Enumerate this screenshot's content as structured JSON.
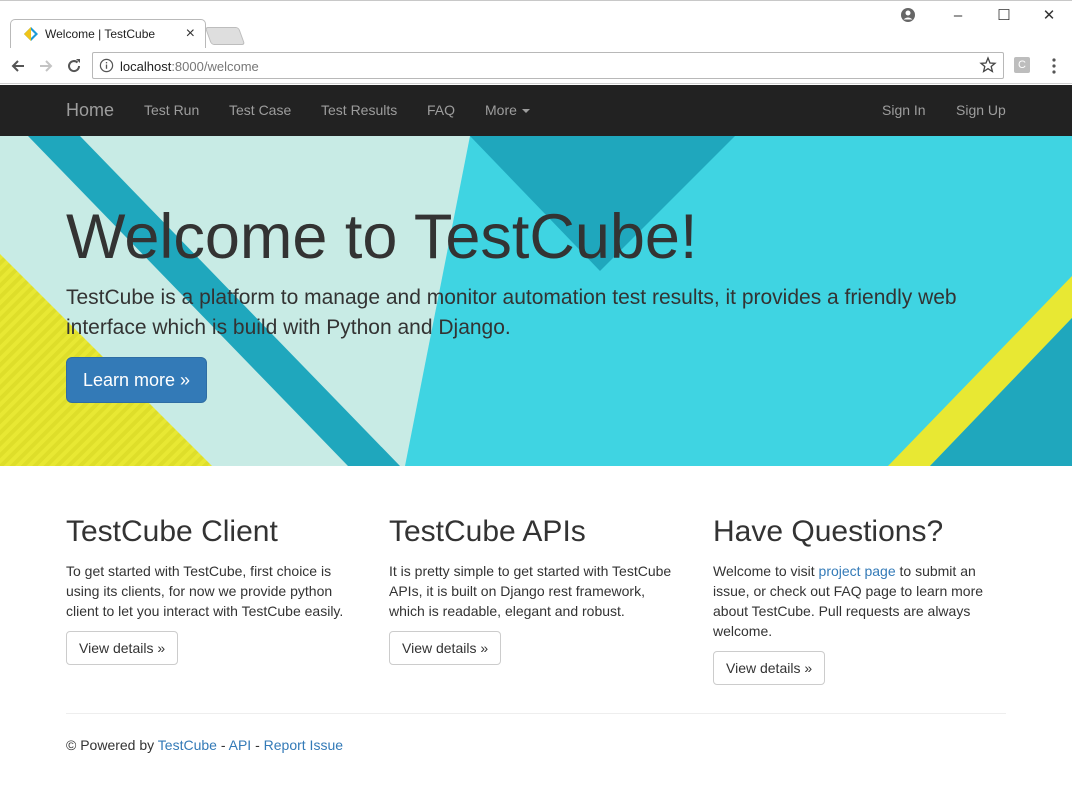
{
  "browser": {
    "tab_title": "Welcome | TestCube",
    "url_host": "localhost",
    "url_path": ":8000/welcome",
    "extension_label": "C"
  },
  "navbar": {
    "brand": "Home",
    "items": [
      "Test Run",
      "Test Case",
      "Test Results",
      "FAQ",
      "More"
    ],
    "right_items": [
      "Sign In",
      "Sign Up"
    ]
  },
  "hero": {
    "title": "Welcome to TestCube!",
    "text": "TestCube is a platform to manage and monitor automation test results, it provides a friendly web interface which is build with Python and Django.",
    "button": "Learn more »"
  },
  "columns": [
    {
      "title": "TestCube Client",
      "text": "To get started with TestCube, first choice is using its clients, for now we provide python client to let you interact with TestCube easily.",
      "button": "View details »"
    },
    {
      "title": "TestCube APIs",
      "text": "It is pretty simple to get started with TestCube APIs, it is built on Django rest framework, which is readable, elegant and robust.",
      "button": "View details »"
    },
    {
      "title": "Have Questions?",
      "text_before": "Welcome to visit ",
      "link": "project page",
      "text_after": " to submit an issue, or check out FAQ page to learn more about TestCube. Pull requests are always welcome.",
      "button": "View details »"
    }
  ],
  "footer": {
    "prefix": "© Powered by ",
    "link1": "TestCube",
    "sep1": " - ",
    "link2": "API",
    "sep2": " - ",
    "link3": "Report Issue"
  },
  "colors": {
    "navbar_bg": "#222222",
    "hero_light": "#c8ebe5",
    "hero_teal": "#3fd4e2",
    "hero_dark_teal": "#1ea8bd",
    "hero_yellow": "#e8e833",
    "primary": "#337ab7"
  }
}
